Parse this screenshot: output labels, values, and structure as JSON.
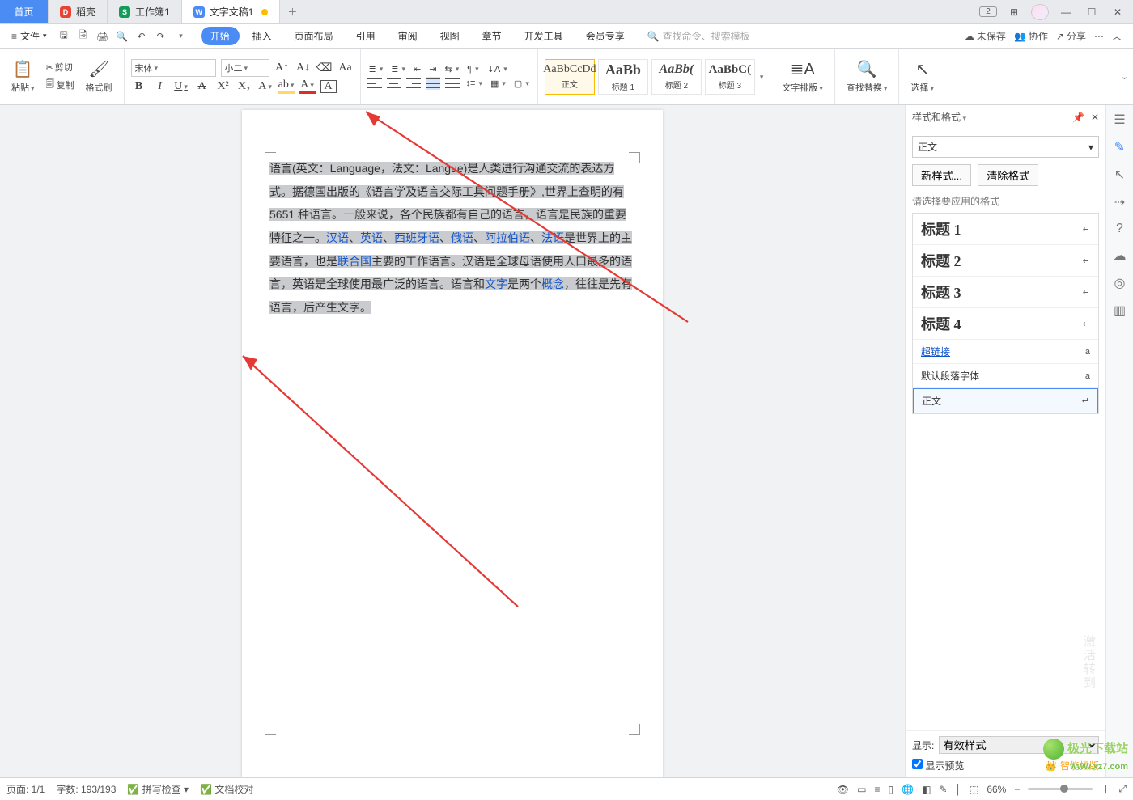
{
  "tabs": {
    "home": "首页",
    "doke": "稻壳",
    "sheet": "工作簿1",
    "doc": "文字文稿1"
  },
  "win": {
    "badge": "2"
  },
  "menu": {
    "file": "文件",
    "tabs": [
      "开始",
      "插入",
      "页面布局",
      "引用",
      "审阅",
      "视图",
      "章节",
      "开发工具",
      "会员专享"
    ],
    "search_ph": "查找命令、搜索模板",
    "unsaved": "未保存",
    "collab": "协作",
    "share": "分享"
  },
  "ribbon": {
    "clip": {
      "cut": "剪切",
      "copy": "复制",
      "paste": "粘贴",
      "fmt": "格式刷"
    },
    "font_name": "宋体",
    "font_size": "小二",
    "styles": {
      "body_prev": "AaBbCcDd",
      "body": "正文",
      "h1_prev": "AaBb",
      "h1": "标题 1",
      "h2_prev": "AaBb(",
      "h2": "标题 2",
      "h3_prev": "AaBbC(",
      "h3": "标题 3"
    },
    "layout": "文字排版",
    "find": "查找替换",
    "select": "选择"
  },
  "doc": {
    "p": [
      "语言(英文：Language，法文：Langue)是人类进行沟通交流的表达方式。据德国出版的《语言学及语言交际工具问题手册》,世界上查明的有 5651 种语言。一般来说，各个民族都有自己的语言，语言是民族的重要特征之一。",
      "是世界上的主要语言，也是",
      "主要的工作语言。汉语是全球母语使用人口最多的语言，英语是全球使用最广泛的语言。语言和",
      "是两个",
      "，往往是先有语言，后产生文字。"
    ],
    "links": {
      "han": "汉语",
      "eng": "英语",
      "spa": "西班牙语",
      "rus": "俄语",
      "ara": "阿拉伯语",
      "fra": "法语",
      "un": "联合国",
      "wen": "文字",
      "gai": "概念"
    },
    "sep": "、"
  },
  "panel": {
    "title": "样式和格式",
    "current": "正文",
    "new_style": "新样式...",
    "clear": "清除格式",
    "caption": "请选择要应用的格式",
    "items": [
      {
        "label": "标题 1",
        "mark": "↵",
        "cls": "h"
      },
      {
        "label": "标题 2",
        "mark": "↵",
        "cls": "h"
      },
      {
        "label": "标题 3",
        "mark": "↵",
        "cls": "h"
      },
      {
        "label": "标题 4",
        "mark": "↵",
        "cls": "h"
      },
      {
        "label": "超链接",
        "mark": "a",
        "cls": "link"
      },
      {
        "label": "默认段落字体",
        "mark": "a",
        "cls": ""
      },
      {
        "label": "正文",
        "mark": "↵",
        "cls": "cur"
      }
    ],
    "show_label": "显示:",
    "show_opt": "有效样式",
    "preview": "显示预览",
    "smart": "智能排版"
  },
  "status": {
    "page": "页面: 1/1",
    "words": "字数: 193/193",
    "spell": "拼写检查",
    "proof": "文档校对",
    "zoom": "66%"
  },
  "watermark": {
    "name": "极光下载站",
    "url": "www.xz7.com"
  },
  "hint": "激活转到"
}
